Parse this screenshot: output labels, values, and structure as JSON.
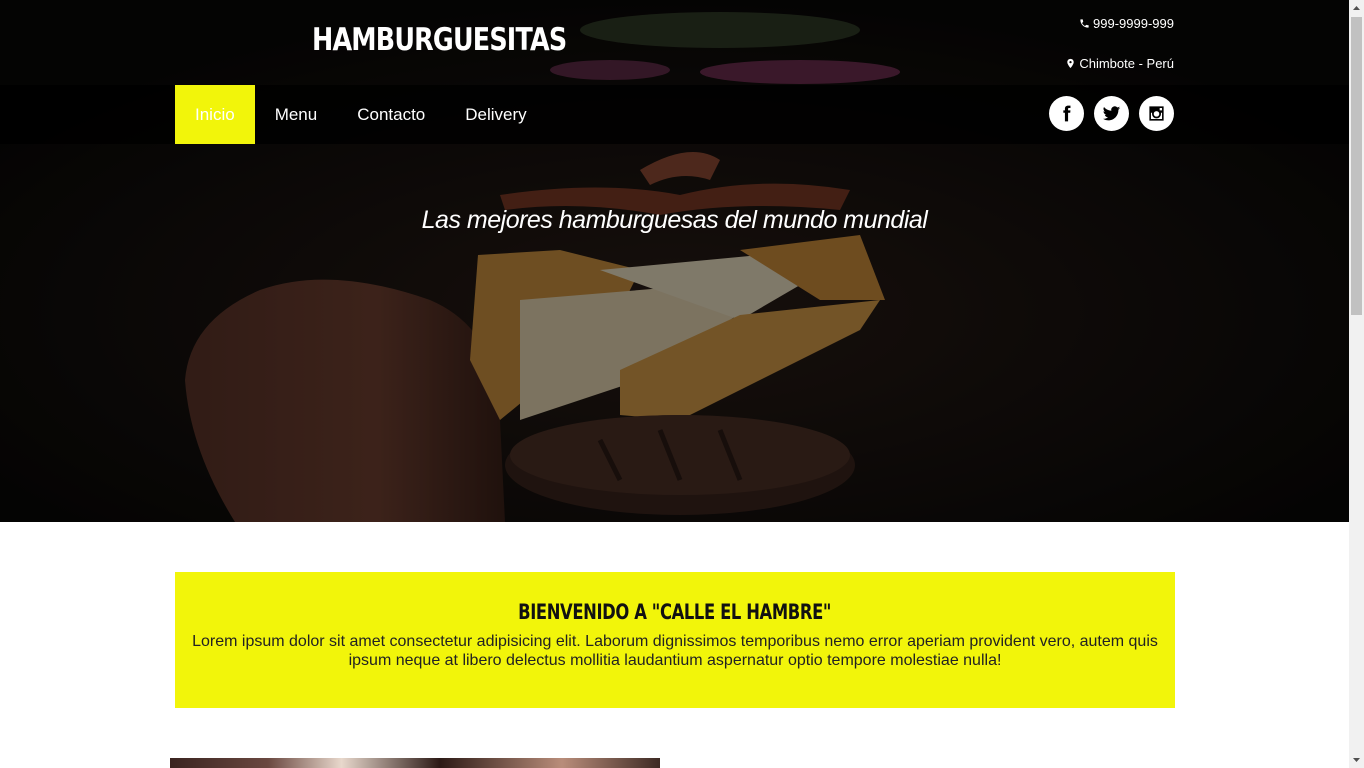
{
  "header": {
    "logo": "HAMBURGUESITAS",
    "phone": "999-9999-999",
    "location": "Chimbote - Perú",
    "phone_icon": "phone-icon",
    "location_icon": "map-marker-icon"
  },
  "nav": {
    "items": [
      {
        "label": "Inicio",
        "active": true
      },
      {
        "label": "Menu",
        "active": false
      },
      {
        "label": "Contacto",
        "active": false
      },
      {
        "label": "Delivery",
        "active": false
      }
    ],
    "active_color": "#f2f50a"
  },
  "socials": [
    {
      "icon": "facebook-icon"
    },
    {
      "icon": "twitter-icon"
    },
    {
      "icon": "instagram-icon"
    }
  ],
  "hero": {
    "tagline": "Las mejores hamburguesas del mundo mundial"
  },
  "welcome": {
    "title": "BIENVENIDO A \"CALLE EL HAMBRE\"",
    "text": "Lorem ipsum dolor sit amet consectetur adipisicing elit. Laborum dignissimos temporibus nemo error aperiam provident vero, autem quis ipsum neque at libero delectus mollitia laudantium aspernatur optio tempore molestiae nulla!",
    "background": "#f2f50a"
  }
}
